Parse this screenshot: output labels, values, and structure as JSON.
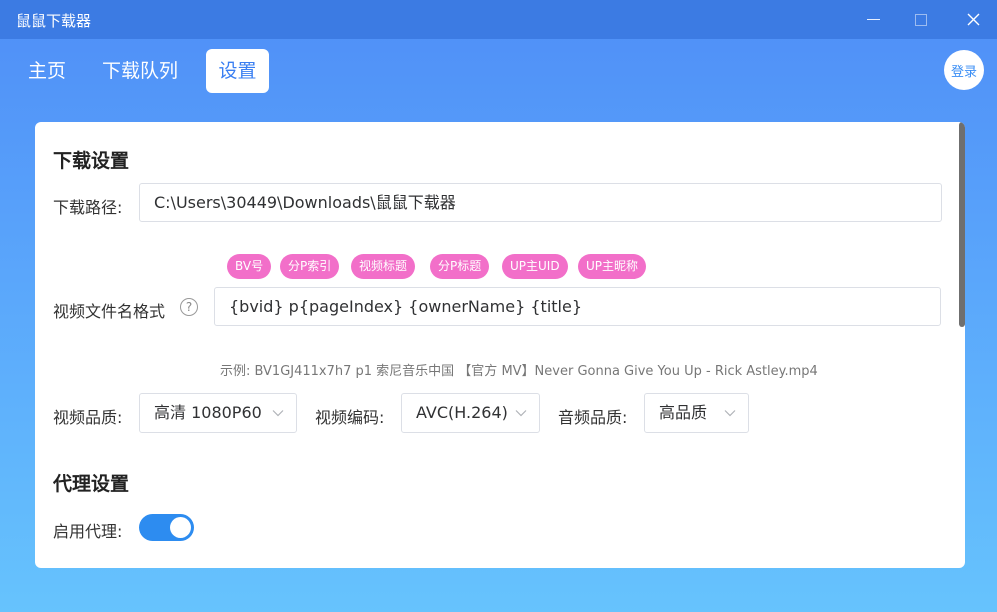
{
  "window": {
    "title": "鼠鼠下载器"
  },
  "nav": {
    "tabs": [
      {
        "label": "主页"
      },
      {
        "label": "下载队列"
      },
      {
        "label": "设置",
        "active": true
      }
    ],
    "login_label": "登录"
  },
  "download": {
    "section_title": "下载设置",
    "path_label": "下载路径:",
    "path_value": "C:\\Users\\30449\\Downloads\\鼠鼠下载器",
    "tags": [
      "BV号",
      "分P索引",
      "视频标题",
      "分P标题",
      "UP主UID",
      "UP主昵称"
    ],
    "filename_label": "视频文件名格式",
    "filename_value": "{bvid} p{pageIndex} {ownerName} {title}",
    "example": "示例: BV1GJ411x7h7 p1 索尼音乐中国 【官方 MV】Never Gonna Give You Up - Rick Astley.mp4",
    "quality_label": "视频品质:",
    "quality_value": "高清 1080P60",
    "codec_label": "视频编码:",
    "codec_value": "AVC(H.264)",
    "audio_label": "音频品质:",
    "audio_value": "高品质"
  },
  "proxy": {
    "section_title": "代理设置",
    "enable_label": "启用代理:",
    "enabled": true
  },
  "colors": {
    "accent": "#2d8cf0",
    "tag": "#f26fc9",
    "titlebar": "#3c7be3"
  }
}
